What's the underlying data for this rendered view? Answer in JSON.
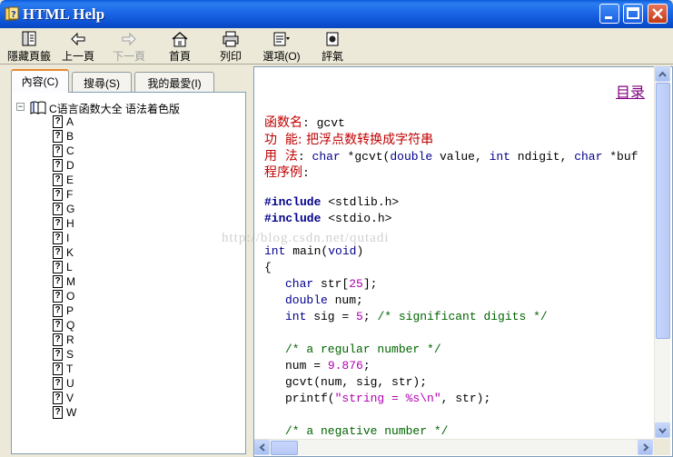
{
  "window": {
    "title": "HTML Help"
  },
  "toolbar": [
    {
      "label": "隱藏頁籤",
      "icon": "hide-tabs-icon",
      "enabled": true
    },
    {
      "label": "上一頁",
      "icon": "back-arrow-icon",
      "enabled": true
    },
    {
      "label": "下一頁",
      "icon": "forward-arrow-icon",
      "enabled": false
    },
    {
      "label": "首頁",
      "icon": "home-icon",
      "enabled": true
    },
    {
      "label": "列印",
      "icon": "print-icon",
      "enabled": true
    },
    {
      "label": "選項(O)",
      "icon": "options-icon",
      "enabled": true
    },
    {
      "label": "評氣",
      "icon": "jump-icon",
      "enabled": true
    }
  ],
  "tabs": [
    {
      "label": "內容(C)",
      "active": true
    },
    {
      "label": "搜尋(S)",
      "active": false
    },
    {
      "label": "我的最愛(I)",
      "active": false
    }
  ],
  "tree": {
    "root": "C语言函数大全 语法着色版",
    "items": [
      "A",
      "B",
      "C",
      "D",
      "E",
      "F",
      "G",
      "H",
      "I",
      "K",
      "L",
      "M",
      "O",
      "P",
      "Q",
      "R",
      "S",
      "T",
      "U",
      "V",
      "W"
    ]
  },
  "content": {
    "toc_link": "目录",
    "func_label": "函数名",
    "func_name": ": gcvt",
    "feature_label": "功  能",
    "feature_text": ": 把浮点数转换成字符串",
    "usage_label": "用  法",
    "usage_colon": ": ",
    "usage_sig": {
      "kw1": "char",
      "t1": " *gcvt(",
      "kw2": "double",
      "t2": " value, ",
      "kw3": "int",
      "t3": " ndigit, ",
      "kw4": "char",
      "t4": " *buf"
    },
    "example_label": "程序例",
    "example_colon": ":",
    "code": {
      "inc1_kw": "#include",
      "inc1_rest": " <stdlib.h>",
      "inc2_kw": "#include",
      "inc2_rest": " <stdio.h>",
      "main_kw": "int",
      "main_rest": " main(",
      "main_void": "void",
      "main_close": ")",
      "brace": "{",
      "l1_kw": "char",
      "l1_a": " str[",
      "l1_num": "25",
      "l1_b": "];",
      "l2_kw": "double",
      "l2_rest": " num;",
      "l3_kw": "int",
      "l3_a": " sig = ",
      "l3_num": "5",
      "l3_b": "; ",
      "l3_cm": "/* significant digits */",
      "c1": "/* a regular number */",
      "l4_a": "num = ",
      "l4_num": "9.876",
      "l4_b": ";",
      "l5": "gcvt(num, sig, str);",
      "l6_a": "printf(",
      "l6_str": "\"string = %s\\n\"",
      "l6_b": ", str);",
      "c2": "/* a negative number */"
    }
  },
  "watermark": "http://blog.csdn.net/qutadi"
}
